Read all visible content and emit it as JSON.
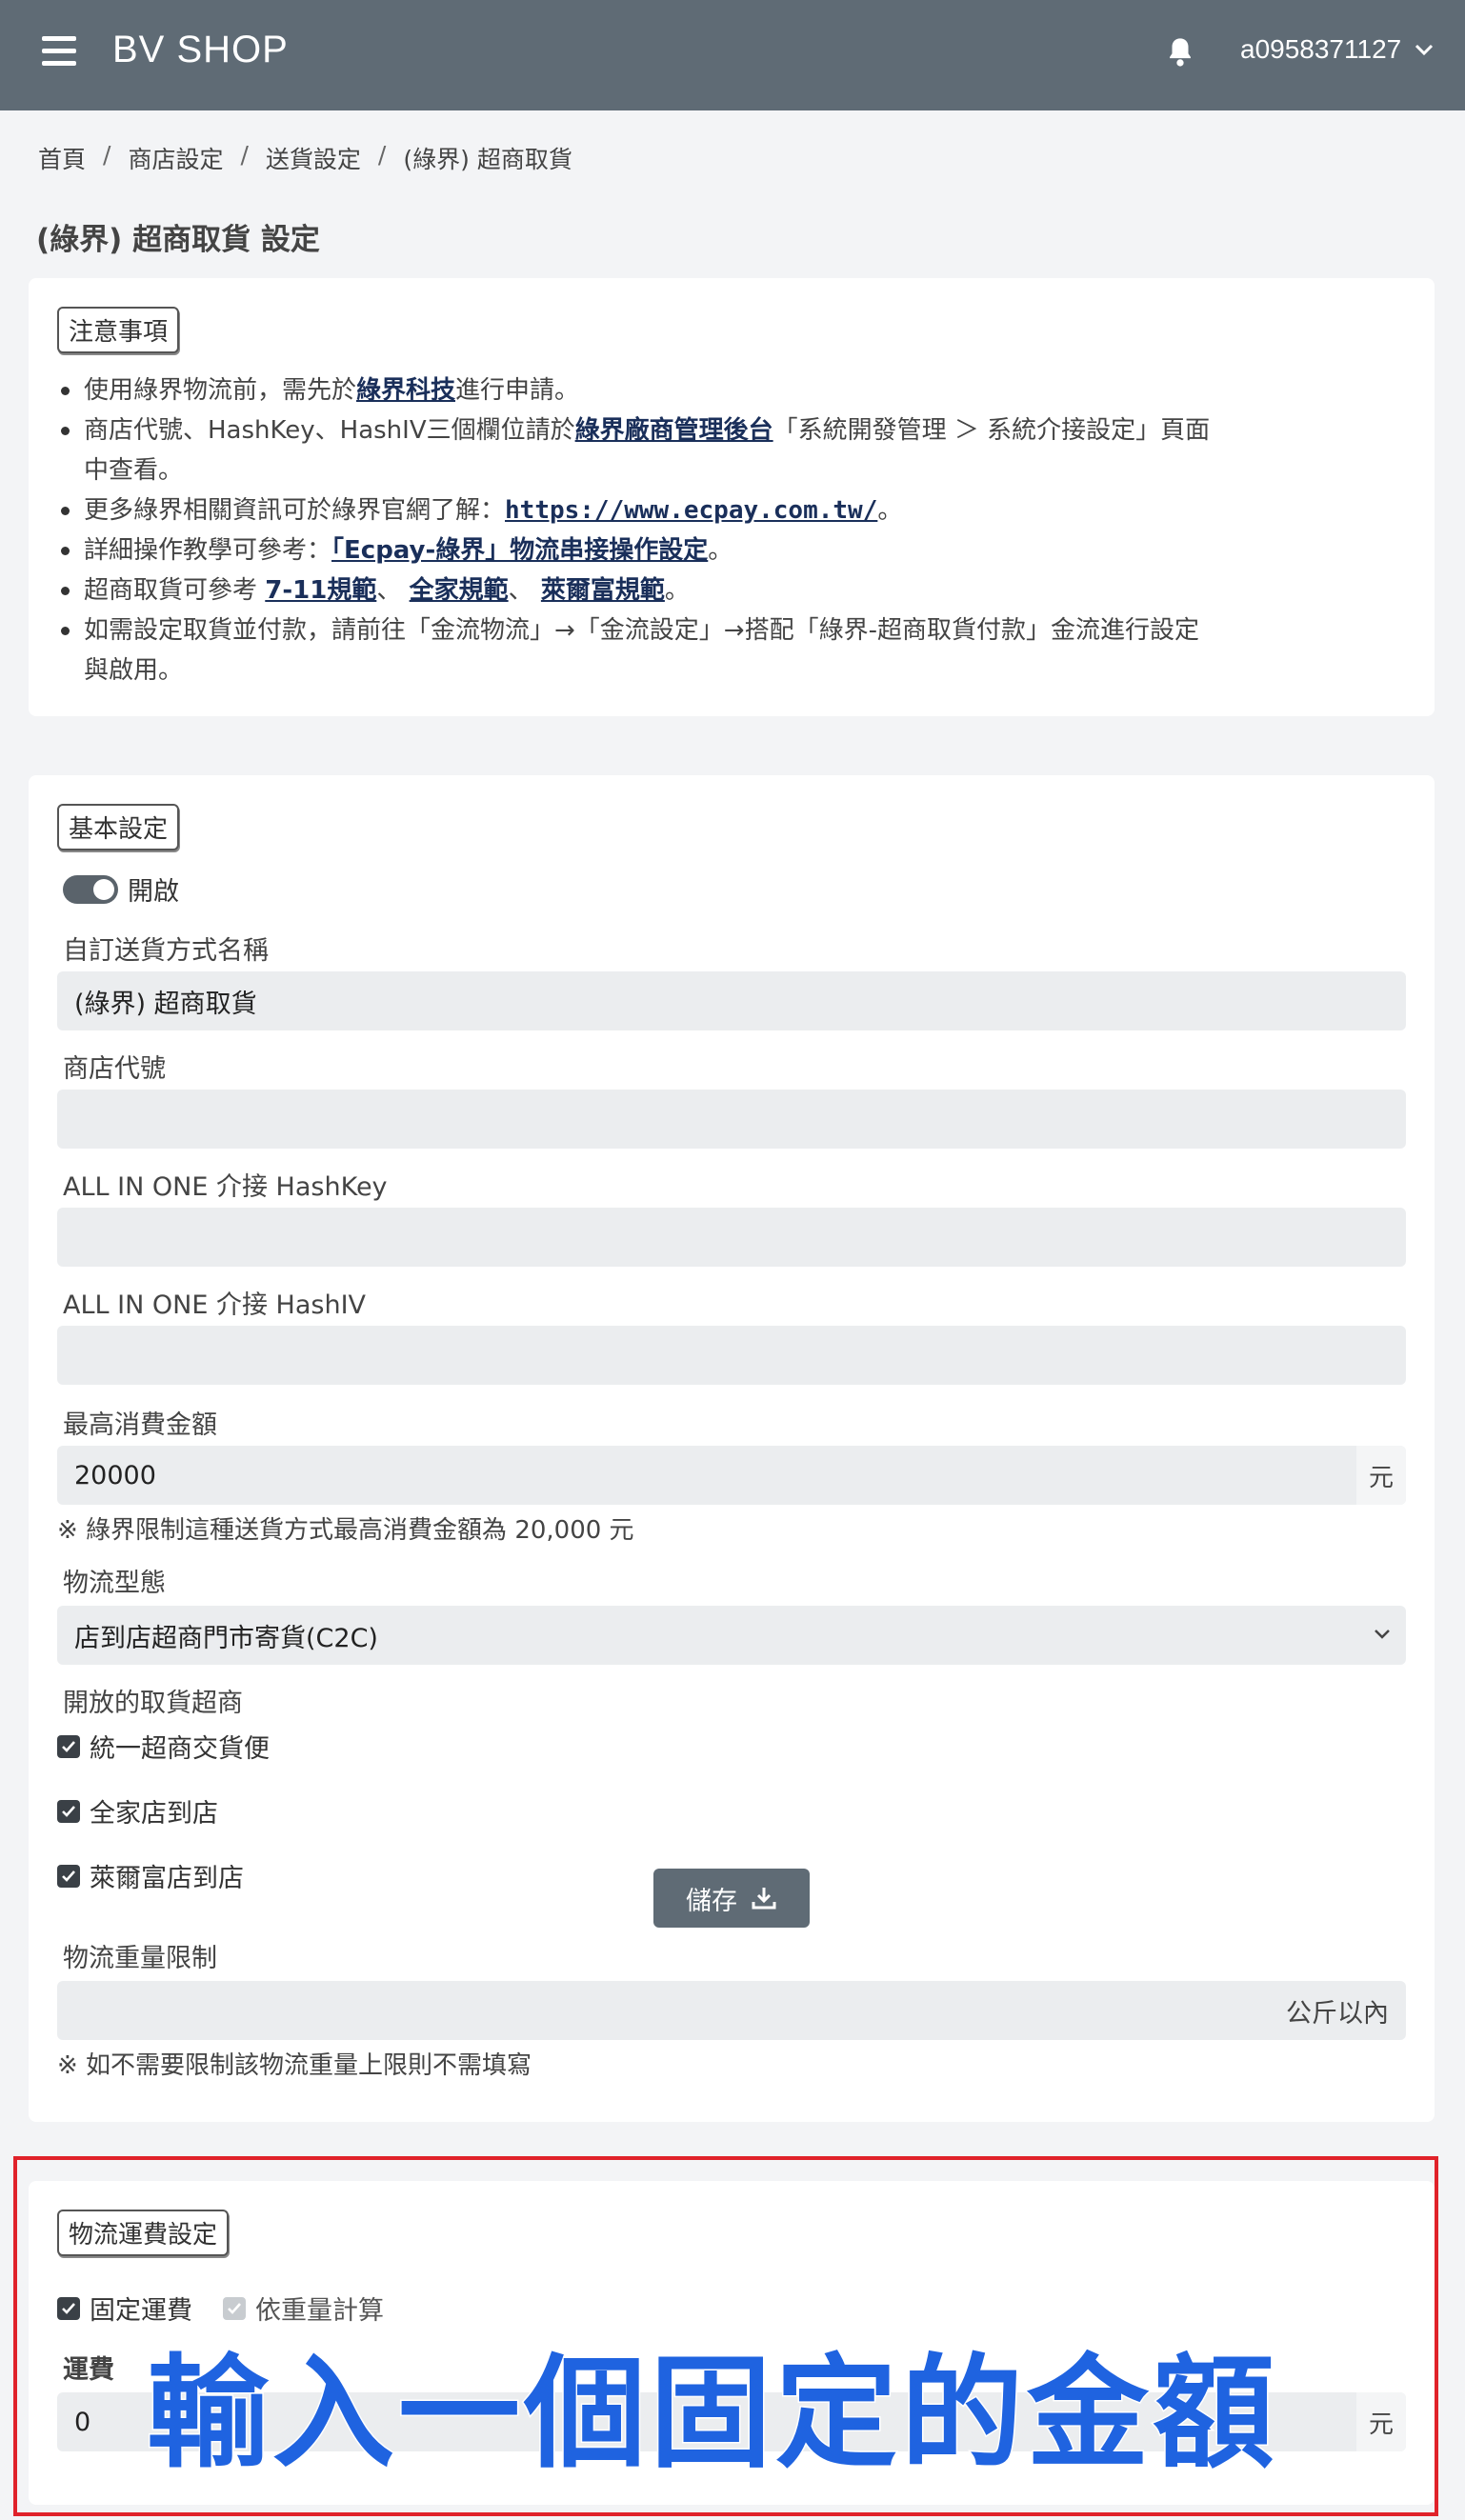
{
  "header": {
    "brand": "BV SHOP",
    "username": "a0958371127"
  },
  "breadcrumb": [
    "首頁",
    "商店設定",
    "送貨設定",
    "(綠界) 超商取貨"
  ],
  "page_title": "(綠界) 超商取貨 設定",
  "notice": {
    "label": "注意事項",
    "l1_a": "使用綠界物流前，需先於",
    "l1_link": "綠界科技",
    "l1_b": "進行申請。",
    "l2_a": "商店代號、HashKey、HashIV三個欄位請於",
    "l2_link": "綠界廠商管理後台",
    "l2_b": "「系統開發管理 ＞ 系統介接設定」頁面",
    "l2_c": "中查看。",
    "l3_a": "更多綠界相關資訊可於綠界官網了解：",
    "l3_link": "https://www.ecpay.com.tw/",
    "l3_b": "。",
    "l4_a": "詳細操作教學可參考：",
    "l4_link": "「Ecpay-綠界」物流串接操作設定",
    "l4_b": "。",
    "l5_a": "超商取貨可參考 ",
    "l5_link1": "7-11規範",
    "l5_sep1": "、 ",
    "l5_link2": "全家規範",
    "l5_sep2": "、 ",
    "l5_link3": "萊爾富規範",
    "l5_b": "。",
    "l6_a": "如需設定取貨並付款，請前往「金流物流」→「金流設定」→搭配「綠界-超商取貨付款」金流進行設定",
    "l6_b": "與啟用。"
  },
  "basic": {
    "label": "基本設定",
    "toggle_label": "開啟",
    "name_label": "自訂送貨方式名稱",
    "name_value": "(綠界) 超商取貨",
    "store_id_label": "商店代號",
    "hashkey_label": "ALL IN ONE 介接 HashKey",
    "hashiv_label": "ALL IN ONE 介接 HashIV",
    "max_label": "最高消費金額",
    "max_value": "20000",
    "max_unit": "元",
    "max_hint": "※ 綠界限制這種送貨方式最高消費金額為 20,000 元",
    "type_label": "物流型態",
    "type_value": "店到店超商門市寄貨(C2C)",
    "stores_label": "開放的取貨超商",
    "store1": "統一超商交貨便",
    "store2": "全家店到店",
    "store3": "萊爾富店到店",
    "weight_label": "物流重量限制",
    "weight_unit": "公斤以內",
    "weight_hint": "※ 如不需要限制該物流重量上限則不需填寫"
  },
  "save_label": "儲存",
  "fee": {
    "label": "物流運費設定",
    "fixed_label": "固定運費",
    "weight_label": "依重量計算",
    "fee_label": "運費",
    "fee_value": "0",
    "fee_unit": "元"
  },
  "overlay_text": "輸入一個固定的金額",
  "colors": {
    "topbar": "#5f6b75",
    "highlight": "#e0222a",
    "overlay": "#1f63e0"
  }
}
